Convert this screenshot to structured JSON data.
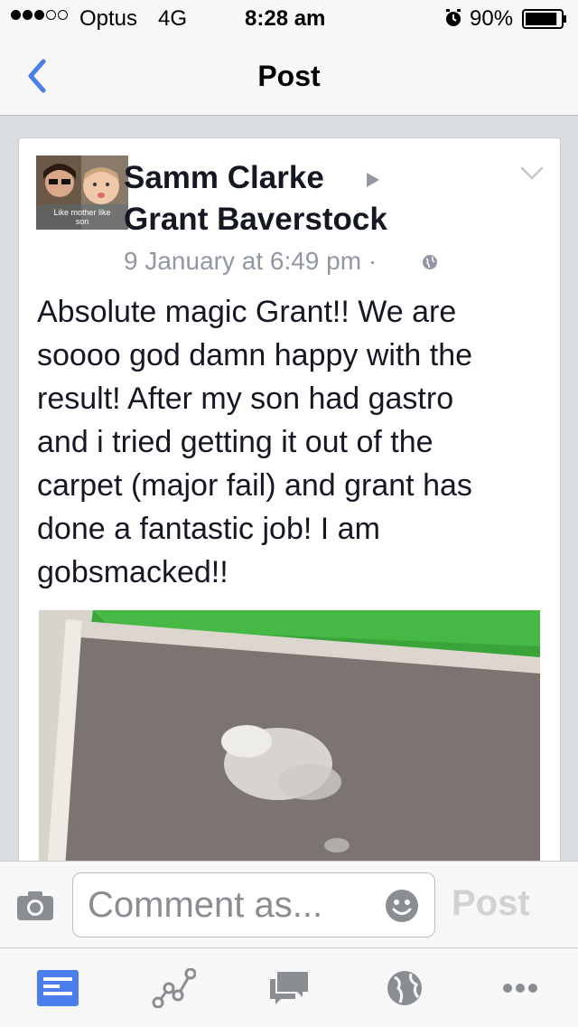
{
  "status": {
    "signal_dots_filled": 3,
    "signal_dots_total": 5,
    "carrier": "Optus",
    "network": "4G",
    "time": "8:28 am",
    "battery_percent": "90%",
    "battery_level": 0.9,
    "icons": [
      "alarm-icon",
      "battery-icon"
    ]
  },
  "nav": {
    "title": "Post",
    "back_icon": "chevron-left-icon",
    "accent": "#4a7eee"
  },
  "post": {
    "author": "Samm Clarke",
    "recipient": "Grant Baverstock",
    "avatar_caption": "Like mother like son",
    "timestamp": "9 January at 6:49 pm ·",
    "privacy_icon": "globe-icon",
    "menu_icon": "chevron-down-icon",
    "text_lines": [
      "Absolute magic Grant!! We are",
      "soooo god damn happy with the",
      "result! After my son had gastro",
      "and i tried getting it out of the",
      "carpet (major fail) and grant has",
      "done a fantastic job! I am",
      "gobsmacked!!"
    ]
  },
  "comment": {
    "placeholder": "Comment as...",
    "post_label": "Post",
    "icons": [
      "camera-icon",
      "emoji-icon"
    ]
  },
  "tabs": [
    {
      "name": "news-feed",
      "icon": "news-feed-icon",
      "active": true
    },
    {
      "name": "activity",
      "icon": "graph-icon",
      "active": false
    },
    {
      "name": "messages",
      "icon": "messages-icon",
      "active": false
    },
    {
      "name": "notifications",
      "icon": "globe-icon",
      "active": false
    },
    {
      "name": "more",
      "icon": "more-icon",
      "active": false
    }
  ]
}
